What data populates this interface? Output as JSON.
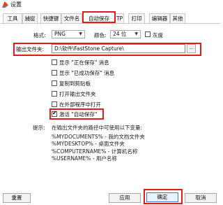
{
  "window": {
    "title": "设置"
  },
  "tabs": [
    {
      "label": "工具栏"
    },
    {
      "label": "捕捉"
    },
    {
      "label": "快捷键"
    },
    {
      "label": "文件名"
    },
    {
      "label": "自动保存"
    },
    {
      "label": "TP"
    },
    {
      "label": "打印"
    },
    {
      "label": "编辑器"
    },
    {
      "label": "其他"
    }
  ],
  "format": {
    "label": "格式:",
    "value": "PNG",
    "color_label": "颜色:",
    "color_value": "24 位",
    "grayscale_label": "灰度"
  },
  "output": {
    "label": "输出文件夹:",
    "path": "D:\\软件\\FastStone Capture\\",
    "browse_label": "..."
  },
  "options": [
    {
      "label": "显示 \"正在保存\" 消息",
      "checked": false
    },
    {
      "label": "显示 \"已成功保存\" 消息",
      "checked": false
    },
    {
      "label": "复制到剪贴板",
      "checked": false
    },
    {
      "label": "打开输出文件夹",
      "checked": false
    },
    {
      "label": "在外部程序中打开",
      "checked": false
    },
    {
      "label": "激活 \"自动保存\"",
      "checked": true
    }
  ],
  "hint": {
    "label": "提示:",
    "lines": [
      "在输出文件夹的路径中可使用以下变量:",
      "%MYDOCUMENTS% - 我的文档文件夹",
      "%MYDESKTOP% - 桌面文件夹",
      "%COMPUTERNAME% - 计算机名称",
      "%USERNAME% - 用户名称"
    ]
  },
  "buttons": {
    "reset": "重置",
    "apply": "应用",
    "ok": "确定",
    "cancel": "取消"
  },
  "colors": {
    "highlight": "#e11b1b",
    "app_icon": "#e8402a"
  }
}
